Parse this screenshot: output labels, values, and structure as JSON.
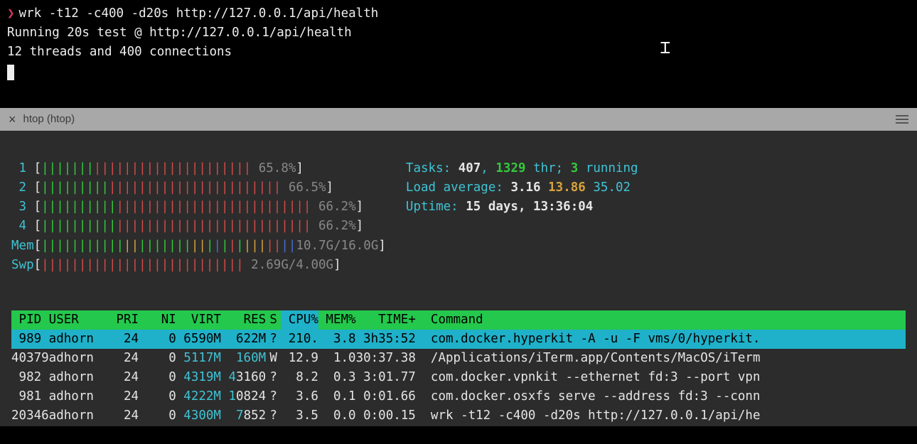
{
  "top_terminal": {
    "prompt": "❯",
    "command": "wrk -t12 -c400 -d20s http://127.0.0.1/api/health",
    "line2": "Running 20s test @ http://127.0.0.1/api/health",
    "line3": "  12 threads and 400 connections"
  },
  "tab": {
    "title": "htop (htop)"
  },
  "meters": {
    "cpus": [
      {
        "id": "1",
        "green": 7,
        "red": 21,
        "pct": "65.8%"
      },
      {
        "id": "2",
        "green": 9,
        "red": 23,
        "pct": "66.5%"
      },
      {
        "id": "3",
        "green": 10,
        "red": 26,
        "pct": "66.2%"
      },
      {
        "id": "4",
        "green": 10,
        "red": 26,
        "pct": "66.2%"
      }
    ],
    "mem": {
      "label": "Mem",
      "used": "10.7G",
      "total": "16.0G"
    },
    "swp": {
      "label": "Swp",
      "used": "2.69G",
      "total": "4.00G"
    }
  },
  "sys": {
    "tasks_label": "Tasks: ",
    "tasks": "407",
    "thr": "1329",
    "thr_suffix": " thr; ",
    "running": "3",
    "running_suffix": " running",
    "load_label": "Load average: ",
    "load1": "3.16",
    "load5": "13.86",
    "load15": "35.02",
    "uptime_label": "Uptime: ",
    "uptime": "15 days, 13:36:04"
  },
  "header": {
    "pid": "PID",
    "user": "USER",
    "pri": "PRI",
    "ni": "NI",
    "virt": "VIRT",
    "res": "RES",
    "s": "S",
    "cpu": "CPU%",
    "mem": "MEM%",
    "time": "TIME+",
    "cmd": "Command"
  },
  "processes": [
    {
      "pid": "989",
      "user": "adhorn",
      "pri": "24",
      "ni": "0",
      "virt": "6590M",
      "res": "622M",
      "s": "?",
      "cpu": "210.",
      "mem": "3.8",
      "time": "3h35:52",
      "cmd": "com.docker.hyperkit -A -u -F vms/0/hyperkit.",
      "hl": true
    },
    {
      "pid": "40379",
      "user": "adhorn",
      "pri": "24",
      "ni": "0",
      "virt": "5117M",
      "res": "160M",
      "s": "W",
      "cpu": "12.9",
      "mem": "1.0",
      "time": "30:37.38",
      "cmd": "/Applications/iTerm.app/Contents/MacOS/iTerm",
      "hl": false
    },
    {
      "pid": "982",
      "user": "adhorn",
      "pri": "24",
      "ni": "0",
      "virt": "4319M",
      "res": "43160",
      "s": "?",
      "cpu": "8.2",
      "mem": "0.3",
      "time": "3:01.77",
      "cmd": "com.docker.vpnkit --ethernet fd:3 --port vpn",
      "hl": false
    },
    {
      "pid": "981",
      "user": "adhorn",
      "pri": "24",
      "ni": "0",
      "virt": "4222M",
      "res": "10824",
      "s": "?",
      "cpu": "3.6",
      "mem": "0.1",
      "time": "0:01.66",
      "cmd": "com.docker.osxfs serve --address fd:3 --conn",
      "hl": false
    },
    {
      "pid": "20346",
      "user": "adhorn",
      "pri": "24",
      "ni": "0",
      "virt": "4300M",
      "res": "7852",
      "s": "?",
      "cpu": "3.5",
      "mem": "0.0",
      "time": "0:00.15",
      "cmd": "wrk -t12 -c400 -d20s http://127.0.0.1/api/he",
      "hl": false
    }
  ]
}
